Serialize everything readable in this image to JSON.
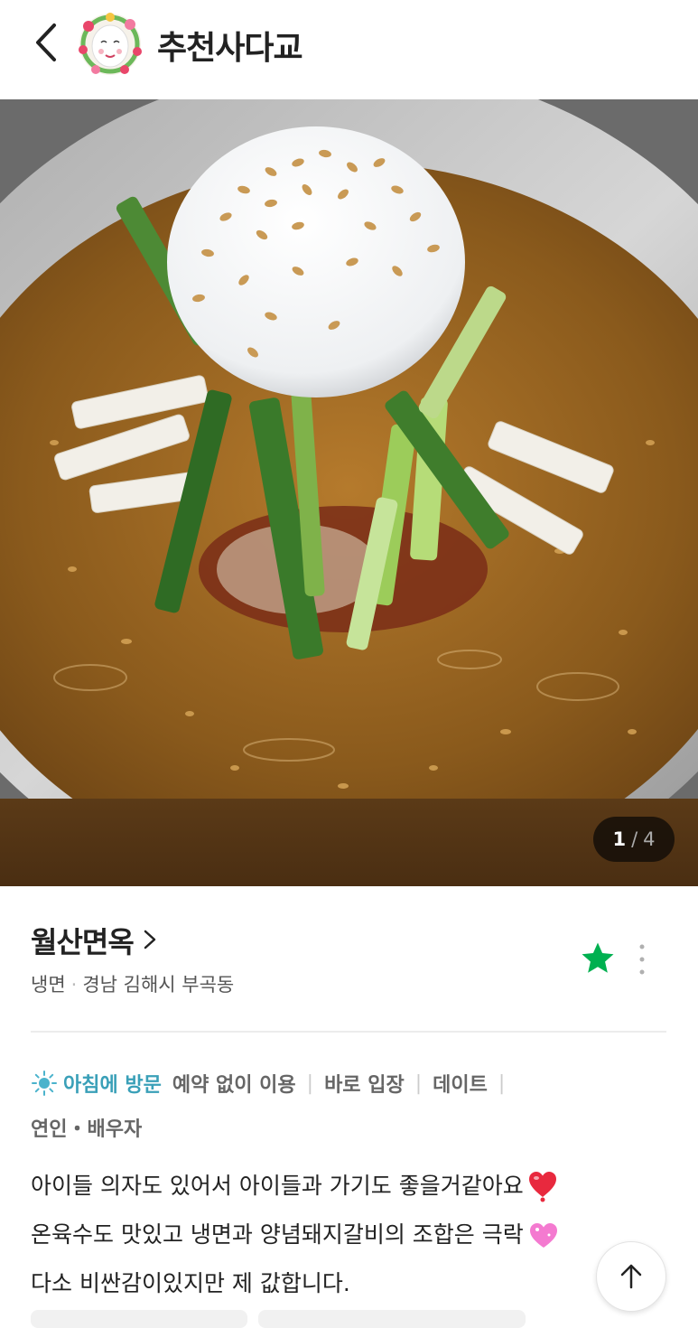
{
  "header": {
    "nickname": "추천사다교"
  },
  "photo": {
    "current": "1",
    "separator": "/",
    "total": "4"
  },
  "place": {
    "name": "월산면옥",
    "category": "냉면",
    "separator": "·",
    "address": "경남 김해시 부곡동"
  },
  "tags": {
    "visit_time": "아침에 방문",
    "items": [
      "예약 없이 이용",
      "바로 입장",
      "데이트"
    ],
    "companion": "연인・배우자"
  },
  "review": {
    "lines": [
      "아이들 의자도 있어서 아이들과 가기도 좋을거같아요",
      "온육수도 맛있고 냉면과 양념돼지갈비의 조합은 극락",
      "다소 비싼감이있지만 제 값합니다."
    ]
  },
  "colors": {
    "star": "#00b050",
    "visit_time": "#3aa0b8",
    "heart_red": "#e8293e",
    "heart_pink": "#f47ad0",
    "broth": "#8a5a1c"
  },
  "icons": {
    "back": "chevron-left-icon",
    "star": "star-icon",
    "more": "more-vertical-icon",
    "sun": "sun-icon",
    "scroll_top": "arrow-up-icon"
  }
}
